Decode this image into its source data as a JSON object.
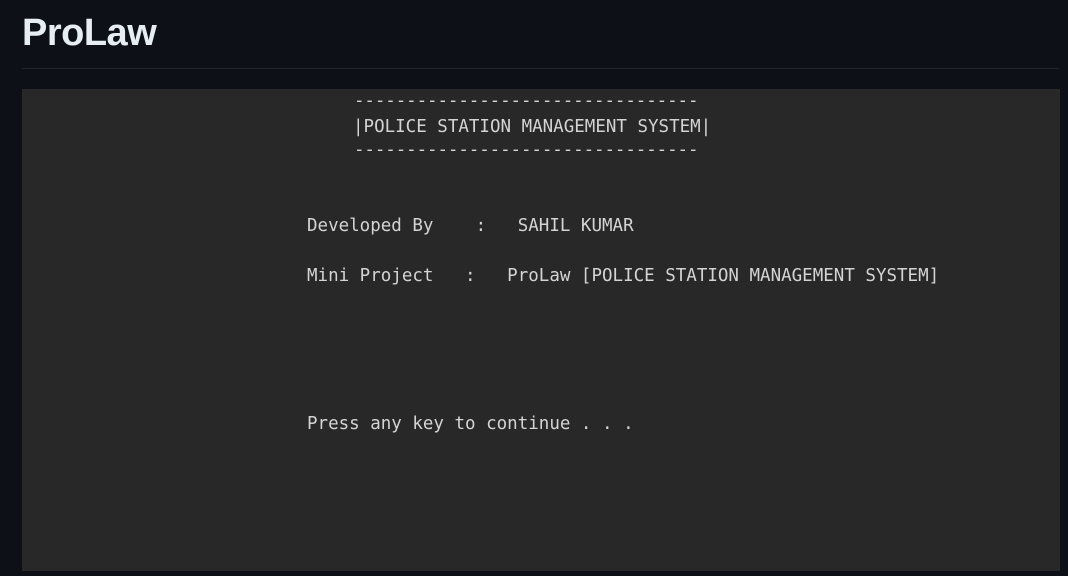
{
  "app": {
    "title": "ProLaw"
  },
  "console": {
    "border": "---------------------------------",
    "banner": "|POLICE STATION MANAGEMENT SYSTEM|",
    "developed_by_line": "Developed By    :   SAHIL KUMAR",
    "mini_project_line": "Mini Project   :   ProLaw [POLICE STATION MANAGEMENT SYSTEM]",
    "continue_prompt": "Press any key to continue . . ."
  },
  "colors": {
    "page_background": "#0d1117",
    "console_background": "#282828",
    "console_text": "#d4d4d4",
    "title_text": "#e6edf3"
  }
}
